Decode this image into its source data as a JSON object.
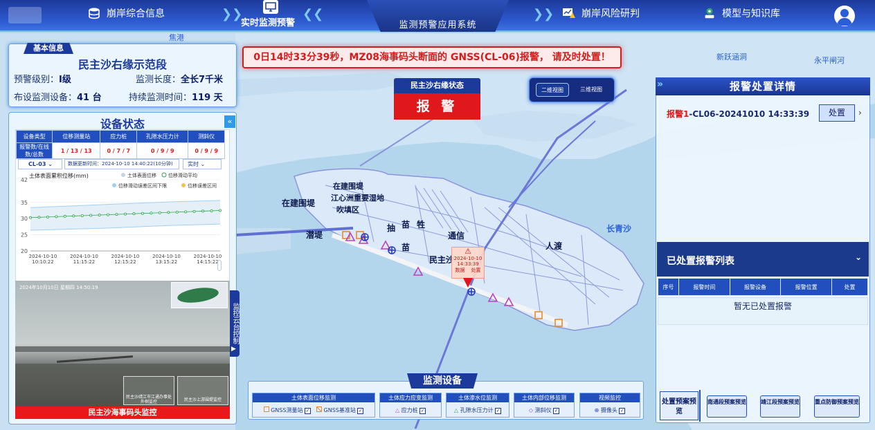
{
  "nav": {
    "items": [
      {
        "label": "崩岸综合信息",
        "icon": "database-icon"
      },
      {
        "label": "实时监测预警",
        "icon": "monitor-alert-icon"
      },
      {
        "label": "崩岸风险研判",
        "icon": "risk-chart-icon"
      },
      {
        "label": "模型与知识库",
        "icon": "model-tree-icon"
      }
    ],
    "system_title": "监测预警应用系统"
  },
  "basic_info": {
    "tag": "基本信息",
    "site_name": "民主沙右缘示范段",
    "warning_level_label": "预警级别：",
    "warning_level_value": "I级",
    "length_label": "监测长度：",
    "length_value": "全长7千米",
    "devices_label": "布设监测设备：",
    "devices_value": "41 台",
    "duration_label": "持续监测时间：",
    "duration_value": "119 天"
  },
  "equipment_status": {
    "title": "设备状态",
    "columns": [
      "设备类型",
      "位移测量站",
      "应力桩",
      "孔隙水压力计",
      "测斜仪"
    ],
    "row_label": "报警数/在线数/总数",
    "row_values": [
      "1 / 13 / 13",
      "0 / 7 / 7",
      "0 / 9 / 9",
      "0 / 9 / 9"
    ],
    "device_select": "CL-03",
    "update_text": "数据更新时间：2024-10-10 14:40:22(10分钟)",
    "mode_select": "实时"
  },
  "chart_data": {
    "type": "line",
    "title": "土体表面累积位移(mm)",
    "legend": [
      "土体表面位移",
      "位移滑动平均",
      "位移滑动误差区间下限",
      "位移误差区间"
    ],
    "ylim": [
      20,
      42
    ],
    "yticks": [
      20,
      25,
      30,
      35,
      42
    ],
    "xticks": [
      "2024-10-10 10:10:22",
      "2024-10-10 11:15:22",
      "2024-10-10 12:15:22",
      "2024-10-10 13:15:22",
      "2024-10-10 14:15:22"
    ],
    "series": [
      {
        "name": "位移滑动平均",
        "values": [
          30.3,
          30.4,
          30.5,
          30.6,
          30.7,
          30.8,
          30.9,
          31.0,
          31.1,
          31.2,
          31.3,
          31.4,
          31.5,
          31.6,
          31.7,
          31.8,
          31.9,
          32.0,
          32.1,
          32.2,
          32.3,
          32.4,
          32.5
        ]
      },
      {
        "name": "位移误差区间上限",
        "values": [
          33.4,
          33.7,
          34.0,
          34.3,
          34.6,
          34.9,
          35.2,
          35.4,
          35.6
        ]
      },
      {
        "name": "位移滑动误差区间下限",
        "values": [
          26.4,
          26.6,
          26.8,
          27.0,
          27.3,
          27.6,
          27.9,
          28.1,
          28.3
        ]
      }
    ]
  },
  "video": {
    "timestamp": "2024年10月10日 星期四 14:50:19",
    "caption": "民主沙海事码头监控",
    "thumbs": [
      "民主沙靖江市江通办事处外侧监控",
      "民主沙上游围堤监控"
    ],
    "control_tab": "监控云台控制"
  },
  "alert": {
    "message": "0日14时33分39秒，MZ08海事码头断面的 GNSS(CL-06)报警， 请及时处置！"
  },
  "status": {
    "title": "民主沙右缘状态",
    "value": "报 警"
  },
  "view_switch": {
    "option1": "二维视图",
    "option2": "三维视图",
    "active": "二维视图"
  },
  "map_labels": {
    "place1": "在建围堤",
    "place2": "在建围堤",
    "place3": "江心洲重要湿地",
    "place4": "吹填区",
    "place5": "潜堤",
    "place6": "抽",
    "place7": "苗",
    "place8": "牲",
    "place9": "通信",
    "place10": "人渡",
    "place11": "民主沙",
    "place12": "苗",
    "place13": "长青沙",
    "place14": "新跃涵洞",
    "place15": "永平闸河",
    "place16": "焦港",
    "marker_time": "2024-10-10 14:33:39",
    "marker_btn1": "数据",
    "marker_btn2": "处置"
  },
  "alarm_detail": {
    "title": "报警处置详情",
    "alarm_prefix": "报警1",
    "alarm_text": "-CL06-20241010 14:33:39",
    "handle_button": "处置"
  },
  "handled_list": {
    "title": "已处置报警列表",
    "columns": [
      "序号",
      "报警时间",
      "报警设备",
      "报警位置",
      "处置"
    ],
    "empty_text": "暂无已处置报警"
  },
  "plans": {
    "label": "处置预案预览",
    "buttons": [
      "南通段预案预览",
      "靖江段预案预览",
      "重点防御预案预览"
    ]
  },
  "monitoring_devices": {
    "title": "监测设备",
    "groups": [
      {
        "title": "土体表面位移监测",
        "items": [
          "GNSS测量站",
          "GNSS基准站"
        ]
      },
      {
        "title": "土体应力应变监测",
        "items": [
          "应力桩"
        ]
      },
      {
        "title": "土体渗水位监测",
        "items": [
          "孔隙水压力计"
        ]
      },
      {
        "title": "土体内部位移监测",
        "items": [
          "测斜仪"
        ]
      },
      {
        "title": "视频监控",
        "items": [
          "摄像头"
        ]
      }
    ]
  },
  "colors": {
    "alarm_red": "#e0181b",
    "navy": "#1c3a9c",
    "band": "#2150be"
  }
}
